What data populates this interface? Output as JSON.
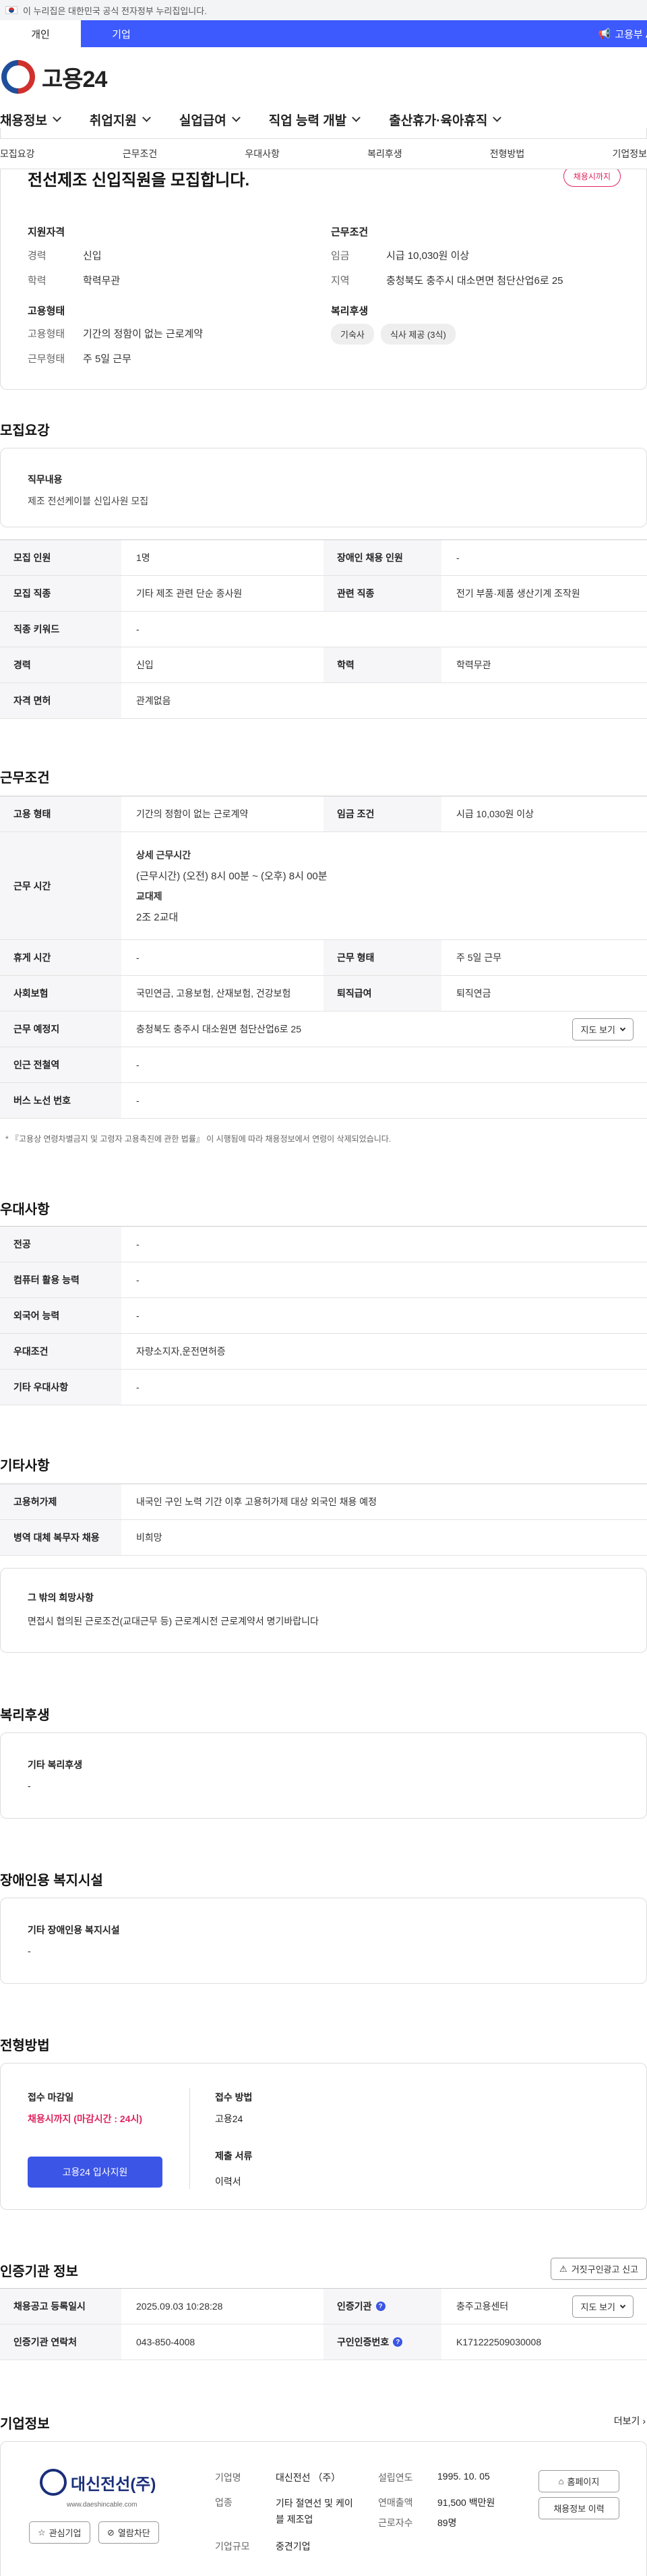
{
  "gov_banner": {
    "text": "이 누리집은 대한민국 공식 전자정부 누리집입니다."
  },
  "tabs": [
    {
      "label": "개인"
    },
    {
      "label": "기업"
    }
  ],
  "ai_link": "고용부 AI 고",
  "logo": {
    "text": "고용24"
  },
  "main_nav": [
    "채용정보",
    "취업지원",
    "실업급여",
    "직업 능력 개발",
    "출산휴가·육아휴직"
  ],
  "anchor_nav": [
    "모집요강",
    "근무조건",
    "우대사항",
    "복리후생",
    "전형방법",
    "기업정보"
  ],
  "summary": {
    "title": "전선제조 신입직원을 모집합니다.",
    "badge": "채용시까지",
    "qual_title": "지원자격",
    "qual": [
      {
        "k": "경력",
        "v": "신입"
      },
      {
        "k": "학력",
        "v": "학력무관"
      }
    ],
    "cond_title": "근무조건",
    "cond": [
      {
        "k": "임금",
        "v": "시급 10,030원 이상"
      },
      {
        "k": "지역",
        "v": "충청북도 충주시 대소면면 첨단산업6로 25"
      }
    ],
    "emp_title": "고용형태",
    "emp": [
      {
        "k": "고용형태",
        "v": "기간의 정함이 없는 근로계약"
      },
      {
        "k": "근무형태",
        "v": "주 5일 근무"
      }
    ],
    "welfare_title": "복리후생",
    "welfare_tags": [
      "기숙사",
      "식사 제공 (3식)"
    ]
  },
  "recruit": {
    "title": "모집요강",
    "duty_label": "직무내용",
    "duty_value": "제조 전선케이블 신입사원 모집",
    "rows": [
      {
        "k1": "모집 인원",
        "v1": "1명",
        "k2": "장애인 채용 인원",
        "v2": "-"
      },
      {
        "k1": "모집 직종",
        "v1": "기타 제조 관련 단순 종사원",
        "k2": "관련 직종",
        "v2": "전기 부품·제품 생산기계 조작원"
      },
      {
        "k": "직종 키워드",
        "v": "-"
      },
      {
        "k1": "경력",
        "v1": "신입",
        "k2": "학력",
        "v2": "학력무관"
      },
      {
        "k": "자격 면허",
        "v": "관계없음"
      }
    ]
  },
  "work": {
    "title": "근무조건",
    "rows": [
      {
        "k1": "고용 형태",
        "v1": "기간의 정함이 없는 근로계약",
        "k2": "임금 조건",
        "v2": "시급 10,030원 이상"
      }
    ],
    "hours_label": "근무 시간",
    "hours_title": "상세 근무시간",
    "hours_detail": "(근무시간) (오전) 8시 00분 ~ (오후) 8시 00분",
    "shift_title": "교대제",
    "shift_value": "2조 2교대",
    "rows2": [
      {
        "k1": "휴게 시간",
        "v1": "-",
        "k2": "근무 형태",
        "v2": "주 5일 근무"
      },
      {
        "k1": "사회보험",
        "v1": "국민연금, 고용보험, 산재보험, 건강보험",
        "k2": "퇴직급여",
        "v2": "퇴직연금"
      }
    ],
    "place_label": "근무 예정지",
    "place_value": "충청북도 충주시 대소원면 첨단산업6로 25",
    "map_button": "지도 보기",
    "rows3": [
      {
        "k": "인근 전철역",
        "v": "-"
      },
      {
        "k": "버스 노선 번호",
        "v": "-"
      }
    ],
    "note": "* 『고용상 연령차별금지 및 고령자 고용촉진에 관한 법률』 이 시행됨에 따라 채용정보에서 연령이 삭제되었습니다."
  },
  "pref": {
    "title": "우대사항",
    "rows": [
      {
        "k": "전공",
        "v": "-"
      },
      {
        "k": "컴퓨터 활용 능력",
        "v": "-"
      },
      {
        "k": "외국어 능력",
        "v": "-"
      },
      {
        "k": "우대조건",
        "v": "자량소지자,운전면허증"
      },
      {
        "k": "기타 우대사항",
        "v": "-"
      }
    ]
  },
  "etc": {
    "title": "기타사항",
    "rows": [
      {
        "k": "고용허가제",
        "v": "내국인 구인 노력 기간 이후 고용허가제 대상 외국인 채용 예정"
      },
      {
        "k": "병역 대체 복무자 채용",
        "v": "비희망"
      }
    ],
    "card_label": "그 밖의 희망사항",
    "card_value": "면접시 협의된 근로조건(교대근무 등) 근로계시전 근로계약서 명기바랍니다"
  },
  "welfare": {
    "title": "복리후생",
    "label": "기타 복리후생",
    "value": "-"
  },
  "disability": {
    "title": "장애인용 복지시설",
    "label": "기타 장애인용 복지시설",
    "value": "-"
  },
  "selection": {
    "title": "전형방법",
    "deadline_label": "접수 마감일",
    "deadline_value": "채용시까지 (마감시간 : 24시)",
    "apply_button": "고용24 입사지원",
    "method_label": "접수 방법",
    "method_value": "고용24",
    "docs_label": "제출 서류",
    "docs_value": "이력서"
  },
  "agency": {
    "title": "인증기관 정보",
    "report_button": "거짓구인광고 신고",
    "rows": [
      {
        "k1": "채용공고 등록일시",
        "v1": "2025.09.03 10:28:28",
        "k2": "인증기관",
        "v2": "충주고용센터"
      },
      {
        "k1": "인증기관 연락처",
        "v1": "043-850-4008",
        "k2": "구인인증번호",
        "v2": "K171222509030008"
      }
    ],
    "map_button": "지도 보기"
  },
  "company": {
    "title": "기업정보",
    "more": "더보기",
    "logo_name": "대신전선(주)",
    "logo_url": "www.daeshincable.com",
    "fav_button": "관심기업",
    "block_button": "열람차단",
    "name_label": "기업명",
    "name_value": "대신전선 （주）",
    "industry_label": "업종",
    "industry_value": "기타 절연선 및 케이블 제조업",
    "size_label": "기업규모",
    "size_value": "중견기업",
    "founded_label": "설립연도",
    "founded_value": "1995. 10. 05",
    "revenue_label": "연매출액",
    "revenue_value": "91,500 백만원",
    "employees_label": "근로자수",
    "employees_value": "89명",
    "homepage_button": "홈페이지",
    "jobs_button": "채용정보 이력"
  },
  "colors": {
    "primary": "#3d5afe",
    "accent_red": "#e0245e",
    "apply_btn": "#3b55e6"
  }
}
